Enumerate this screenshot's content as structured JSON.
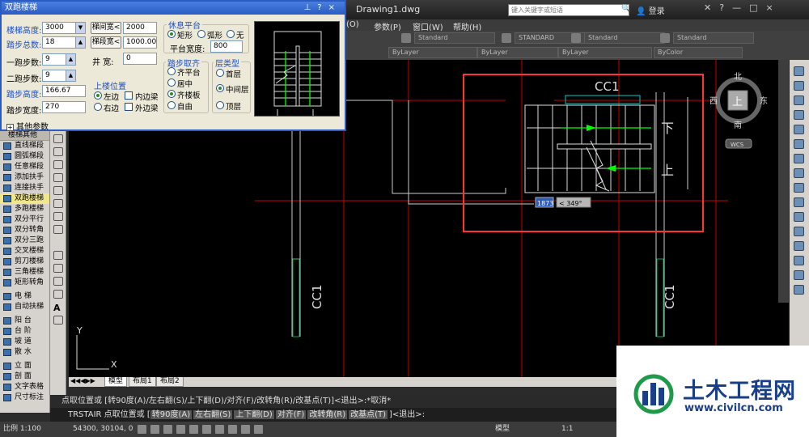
{
  "window": {
    "title": "Drawing1.dwg",
    "search_placeholder": "键入关键字或短语",
    "login_label": "登录"
  },
  "menu": {
    "items": [
      "(O)",
      "参数(P)",
      "窗口(W)",
      "帮助(H)"
    ]
  },
  "toolbar": {
    "text_style": "Standard",
    "dim_style": "STANDARD",
    "table_style": "Standard",
    "mleader_style": "Standard",
    "layer_color": "ByLayer",
    "linetype": "ByLayer",
    "lineweight": "ByLayer",
    "plot_color": "ByColor"
  },
  "dialog": {
    "title": "双跑楼梯",
    "stair_height_label": "楼梯高度:",
    "stair_height": "3000",
    "steps_total_label": "踏步总数:",
    "steps_total": "18",
    "flight1_steps_label": "一跑步数:",
    "flight1_steps": "9",
    "flight2_steps_label": "二跑步数:",
    "flight2_steps": "9",
    "step_height_label": "踏步高度:",
    "step_height": "166.67",
    "step_width_label": "踏步宽度:",
    "step_width": "270",
    "btn_stair_width": "梯间宽<",
    "stair_width_value": "2000",
    "btn_flight_width": "梯段宽<",
    "flight_width_value": "1000.00",
    "well_width_label": "井  宽:",
    "well_width": "0",
    "rest_platform_title": "休息平台",
    "platform_rect": "矩形",
    "platform_arc": "弧形",
    "platform_none": "无",
    "platform_width_label": "平台宽度:",
    "platform_width": "800",
    "up_position_title": "上楼位置",
    "up_left": "左边",
    "up_right": "右边",
    "inner_beam": "内边梁",
    "outer_beam": "外边梁",
    "step_align_title": "踏步取齐",
    "align_platform": "齐平台",
    "align_center": "居中",
    "align_flight": "齐楼板",
    "align_free": "自由",
    "floor_type_title": "层类型",
    "floor_first": "首层",
    "floor_middle": "中间层",
    "floor_top": "顶层",
    "more_params": "其他参数"
  },
  "palette": {
    "header": "楼梯其他",
    "items": [
      {
        "label": "直线梯段"
      },
      {
        "label": "圆弧梯段"
      },
      {
        "label": "任意梯段"
      },
      {
        "label": "添加扶手"
      },
      {
        "label": "连接扶手"
      },
      {
        "label": "双跑楼梯"
      },
      {
        "label": "多跑楼梯"
      },
      {
        "label": "双分平行"
      },
      {
        "label": "双分转角"
      },
      {
        "label": "双分三跑"
      },
      {
        "label": "交叉楼梯"
      },
      {
        "label": "剪刀楼梯"
      },
      {
        "label": "三角楼梯"
      },
      {
        "label": "矩形转角"
      },
      {
        "label": "电    梯"
      },
      {
        "label": "自动扶梯"
      },
      {
        "label": "阳    台"
      },
      {
        "label": "台    阶"
      },
      {
        "label": "坡    道"
      },
      {
        "label": "散    水"
      },
      {
        "label": "立    面"
      },
      {
        "label": "剖    面"
      },
      {
        "label": "文字表格"
      },
      {
        "label": "尺寸标注"
      }
    ],
    "selected_index": 5
  },
  "drawing": {
    "label_cc1_top": "CC1",
    "label_cc1_left": "CC1",
    "label_cc1_right": "CC1",
    "label_down": "下",
    "label_up": "上",
    "dyn_input_value": "1873",
    "dyn_input_angle": "< 349°",
    "ucs_x": "X",
    "ucs_y": "Y"
  },
  "viewcube": {
    "north": "北",
    "south": "南",
    "east": "东",
    "west": "西",
    "top": "上",
    "wcs": "WCS"
  },
  "tabs": [
    "模型",
    "布局1",
    "布局2"
  ],
  "command": {
    "line1": "点取位置或 [转90度(A)/左右翻(S)/上下翻(D)/对齐(F)/改转角(R)/改基点(T)]<退出>:*取消*",
    "line2_prefix": "TRSTAIR 点取位置或 [",
    "line2_options": [
      "转90度(A)",
      "左右翻(S)",
      "上下翻(D)",
      "对齐(F)",
      "改转角(R)",
      "改基点(T)"
    ],
    "line2_suffix": "]<退出>:"
  },
  "status": {
    "scale": "比例 1:100",
    "coords": "54300, 30104, 0",
    "model": "模型",
    "annotation_scale": "1:1"
  },
  "watermark": {
    "cn": "土木工程网",
    "url": "www.civilcn.com"
  }
}
